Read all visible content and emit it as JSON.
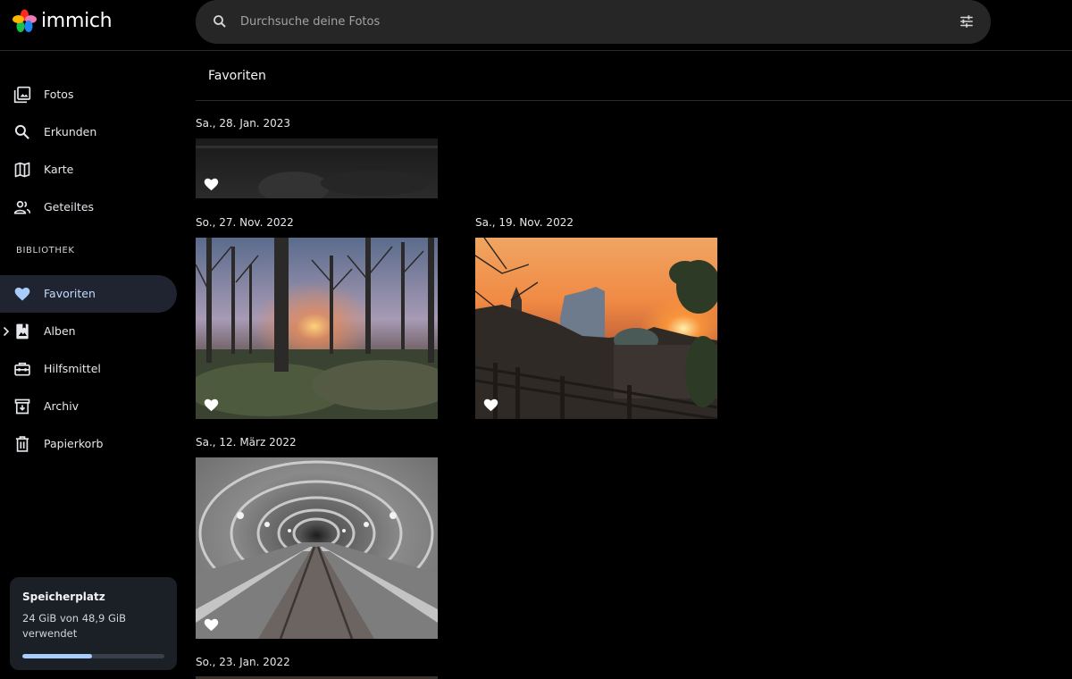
{
  "app": {
    "name": "immich"
  },
  "search": {
    "placeholder": "Durchsuche deine Fotos"
  },
  "sidebar": {
    "items": [
      {
        "label": "Fotos",
        "icon": "photos-icon"
      },
      {
        "label": "Erkunden",
        "icon": "search-icon"
      },
      {
        "label": "Karte",
        "icon": "map-icon"
      },
      {
        "label": "Geteiltes",
        "icon": "people-icon"
      }
    ],
    "section_title": "BIBLIOTHEK",
    "library_items": [
      {
        "label": "Favoriten",
        "icon": "heart-icon",
        "active": true
      },
      {
        "label": "Alben",
        "icon": "album-icon"
      },
      {
        "label": "Hilfsmittel",
        "icon": "toolbox-icon"
      },
      {
        "label": "Archiv",
        "icon": "archive-icon"
      },
      {
        "label": "Papierkorb",
        "icon": "trash-icon"
      }
    ]
  },
  "storage": {
    "title": "Speicherplatz",
    "text": "24 GiB von 48,9 GiB verwendet",
    "used_fraction": 0.49
  },
  "page": {
    "title": "Favoriten"
  },
  "groups": [
    {
      "date": "Sa., 28. Jan. 2023"
    },
    {
      "date": "So., 27. Nov. 2022"
    },
    {
      "date": "Sa., 19. Nov. 2022"
    },
    {
      "date": "Sa., 12. März 2022"
    },
    {
      "date": "So., 23. Jan. 2022"
    }
  ],
  "colors": {
    "accent": "#a8cdfc",
    "active_bg": "#1f2430",
    "search_bg": "#262626"
  }
}
